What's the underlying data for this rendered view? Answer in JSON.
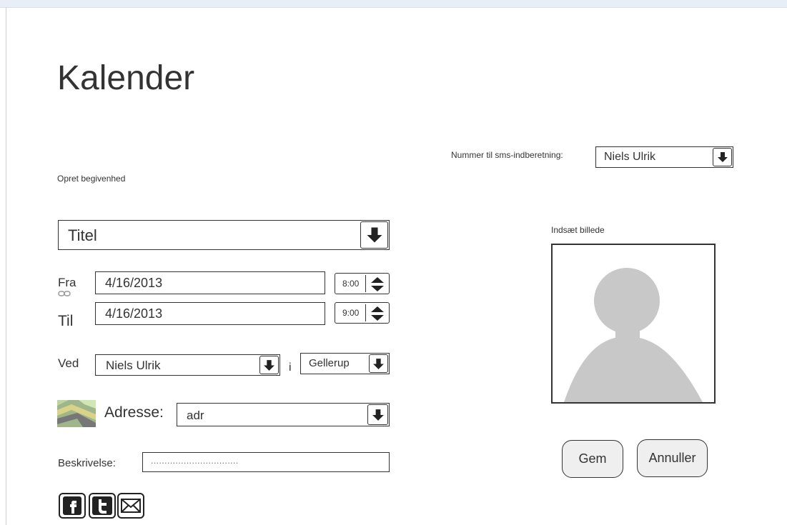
{
  "header": {
    "title": "Kalender"
  },
  "form": {
    "section_label": "Opret begivenhed",
    "sms": {
      "label": "Nummer til sms-indberetning:",
      "selected": "Niels Ulrik"
    },
    "title_field": {
      "value": "Titel"
    },
    "from": {
      "label": "Fra",
      "date": "4/16/2013",
      "time": "8:00"
    },
    "to": {
      "label": "Til",
      "date": "4/16/2013",
      "time": "9:00"
    },
    "at": {
      "label": "Ved",
      "person": "Niels Ulrik",
      "in_label": "i",
      "location": "Gellerup"
    },
    "address": {
      "label": "Adresse:",
      "value": "adr"
    },
    "description": {
      "label": "Beskrivelse:",
      "placeholder": "................................"
    }
  },
  "photo": {
    "label": "Indsæt billede"
  },
  "actions": {
    "save_label": "Gem",
    "cancel_label": "Annuller"
  },
  "social": {
    "icons": [
      "facebook-icon",
      "twitter-icon",
      "email-icon"
    ]
  }
}
